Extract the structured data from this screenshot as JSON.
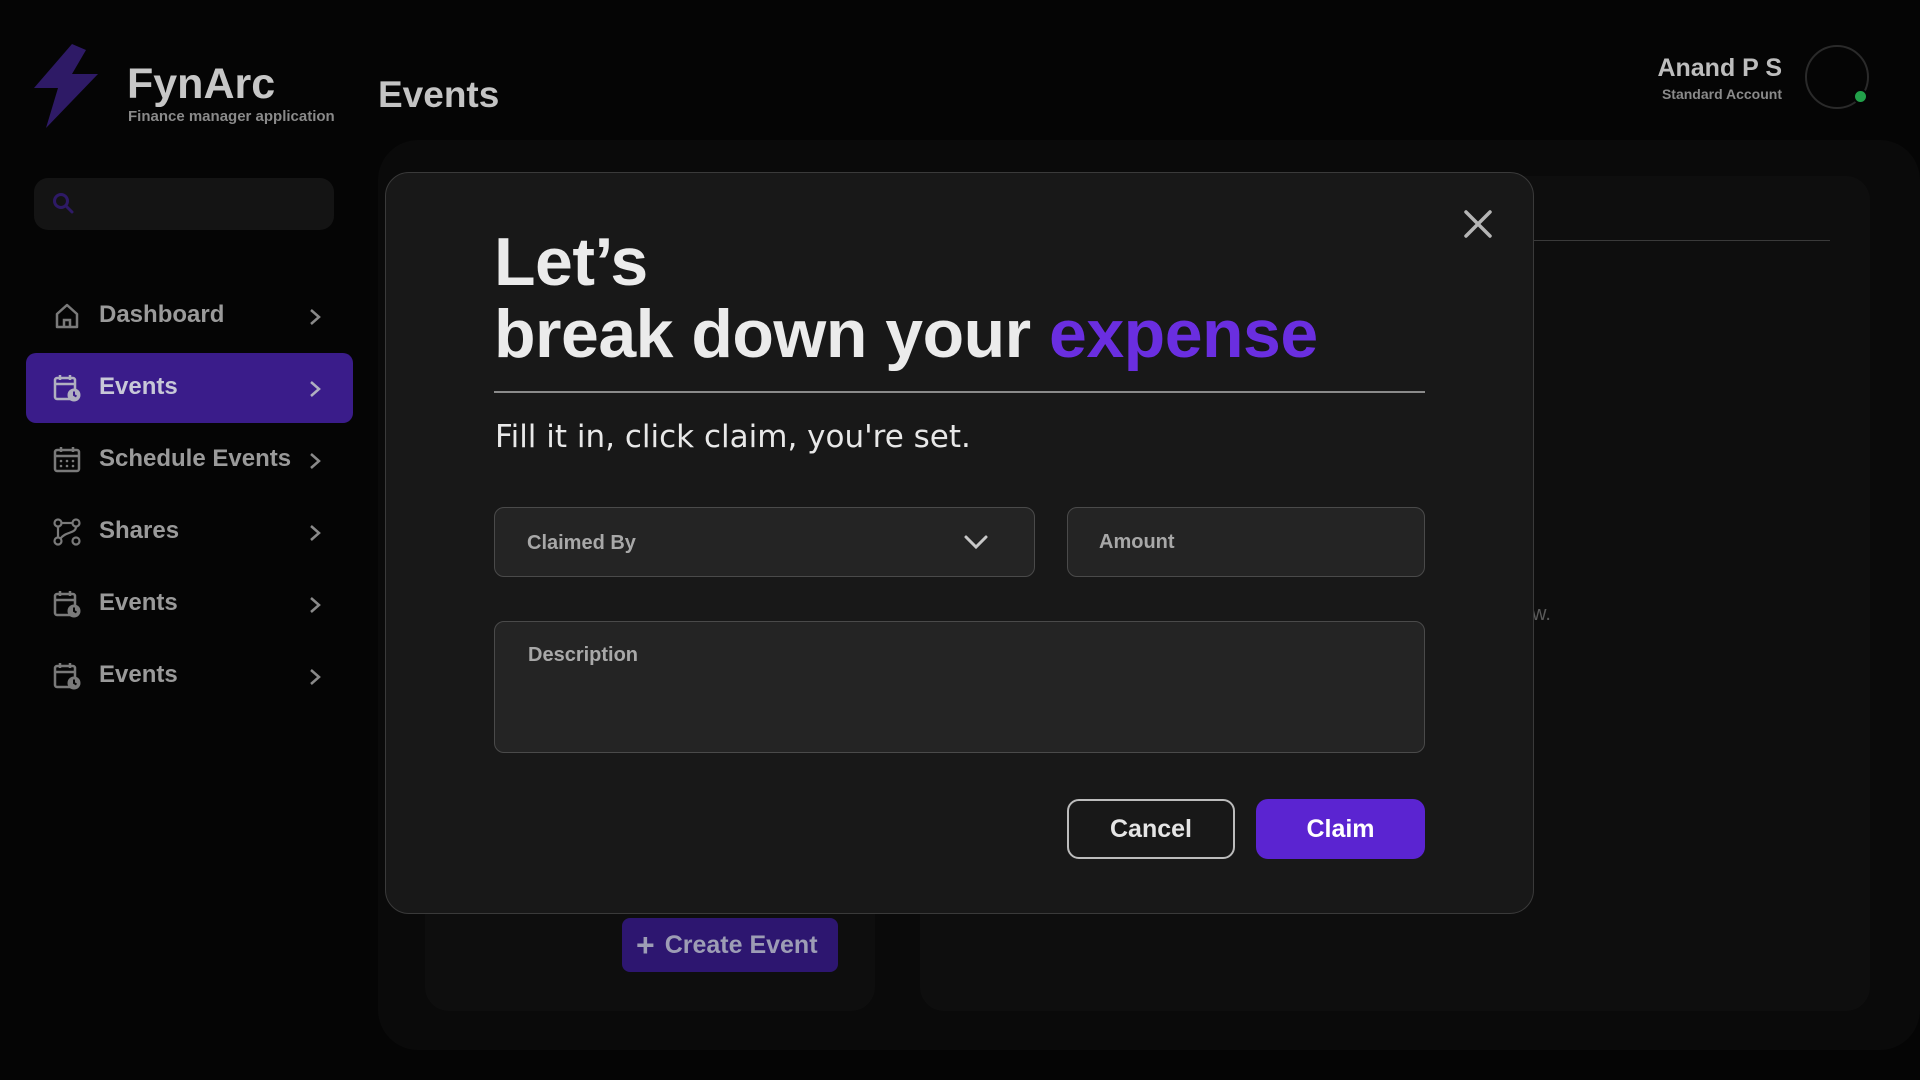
{
  "brand": {
    "name": "FynArc",
    "subtitle": "Finance manager application"
  },
  "header": {
    "title": "Events"
  },
  "user": {
    "name": "Anand P S",
    "role": "Standard Account",
    "status_color": "#22a14a"
  },
  "search": {
    "placeholder": ""
  },
  "sidebar": {
    "items": [
      {
        "label": "Dashboard",
        "icon": "home-icon",
        "active": false
      },
      {
        "label": "Events",
        "icon": "calendar-clock-icon",
        "active": true
      },
      {
        "label": "Schedule Events",
        "icon": "calendar-grid-icon",
        "active": false
      },
      {
        "label": "Shares",
        "icon": "share-nodes-icon",
        "active": false
      },
      {
        "label": "Events",
        "icon": "calendar-clock-icon",
        "active": false
      },
      {
        "label": "Events",
        "icon": "calendar-clock-icon",
        "active": false
      }
    ]
  },
  "background": {
    "create_event_label": "Create Event",
    "partial_text": "w."
  },
  "modal": {
    "heading_line1": "Let’s",
    "heading_line2": "break down your",
    "heading_accent": "expense",
    "subtext": "Fill it in, click claim, you're set.",
    "claimed_by_label": "Claimed By",
    "amount_label": "Amount",
    "description_label": "Description",
    "cancel_label": "Cancel",
    "claim_label": "Claim"
  },
  "colors": {
    "accent": "#5b24d1",
    "heading_accent": "#6a2ee0",
    "active_nav": "#3a1c8a"
  }
}
